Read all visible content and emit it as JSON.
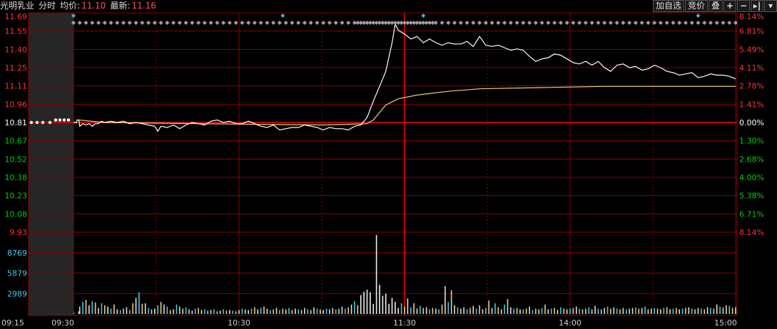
{
  "header": {
    "stock_name": "光明乳业",
    "mode_label": "分时",
    "avg_label": "均价:",
    "avg_value": "11.10",
    "last_label": "最新:",
    "last_value": "11.16"
  },
  "toolbar": {
    "add_watch_label": "加自选",
    "bid_label": "竞价",
    "overlay_label": "叠",
    "zoom_in_label": "+",
    "zoom_out_label": "−",
    "more_label": "▾"
  },
  "colors": {
    "up": "#ff3232",
    "down": "#00d000",
    "flat": "#ffffff",
    "grid": "#8b0000",
    "price_line": "#ffffff",
    "avg_line": "#e6d27a",
    "volume_axis": "#49c8e6"
  },
  "chart_data": {
    "type": "line",
    "prev_close": 10.81,
    "price_axis_labels": [
      "11.69",
      "11.55",
      "11.40",
      "11.25",
      "11.11",
      "10.96",
      "10.81",
      "10.67",
      "10.52",
      "10.38",
      "10.23",
      "10.08",
      "9.93"
    ],
    "pct_axis_labels": [
      "8.14%",
      "6.81%",
      "5.49%",
      "4.11%",
      "2.78%",
      "1.41%",
      "0.00%",
      "1.30%",
      "2.68%",
      "4.00%",
      "5.38%",
      "6.71%",
      "8.14%"
    ],
    "ylim": [
      9.93,
      11.69
    ],
    "volume_axis_labels": [
      "8769",
      "5879",
      "2989"
    ],
    "volume_max": 11659,
    "x_labels": [
      "09:15",
      "09:30",
      "10:30",
      "11:30",
      "14:00",
      "15:00"
    ],
    "price_series": [
      [
        0,
        10.81
      ],
      [
        0.14,
        10.81
      ],
      [
        0.29,
        10.81
      ],
      [
        0.43,
        10.81
      ],
      [
        0.57,
        10.81
      ],
      [
        0.71,
        10.81
      ],
      [
        0.86,
        10.81
      ],
      [
        1.0,
        10.81
      ],
      [
        1.14,
        10.83
      ],
      [
        1.29,
        10.83
      ],
      [
        1.43,
        10.83
      ],
      [
        1.57,
        10.83
      ],
      [
        1.71,
        10.83
      ],
      [
        2,
        10.78
      ],
      [
        3,
        10.8
      ],
      [
        4,
        10.79
      ],
      [
        5,
        10.8
      ],
      [
        6,
        10.78
      ],
      [
        7,
        10.8
      ],
      [
        8,
        10.8
      ],
      [
        9,
        10.82
      ],
      [
        10,
        10.81
      ],
      [
        12,
        10.82
      ],
      [
        14,
        10.81
      ],
      [
        16,
        10.82
      ],
      [
        18,
        10.8
      ],
      [
        20,
        10.81
      ],
      [
        22,
        10.8
      ],
      [
        24,
        10.79
      ],
      [
        26,
        10.78
      ],
      [
        27,
        10.74
      ],
      [
        28,
        10.78
      ],
      [
        30,
        10.77
      ],
      [
        32,
        10.79
      ],
      [
        34,
        10.76
      ],
      [
        36,
        10.79
      ],
      [
        38,
        10.81
      ],
      [
        40,
        10.8
      ],
      [
        42,
        10.79
      ],
      [
        44,
        10.82
      ],
      [
        46,
        10.83
      ],
      [
        48,
        10.81
      ],
      [
        50,
        10.82
      ],
      [
        52,
        10.8
      ],
      [
        54,
        10.8
      ],
      [
        56,
        10.82
      ],
      [
        58,
        10.8
      ],
      [
        60,
        10.78
      ],
      [
        62,
        10.77
      ],
      [
        64,
        10.79
      ],
      [
        66,
        10.75
      ],
      [
        68,
        10.76
      ],
      [
        70,
        10.77
      ],
      [
        72,
        10.77
      ],
      [
        74,
        10.79
      ],
      [
        76,
        10.78
      ],
      [
        78,
        10.77
      ],
      [
        80,
        10.75
      ],
      [
        82,
        10.77
      ],
      [
        84,
        10.76
      ],
      [
        86,
        10.76
      ],
      [
        88,
        10.75
      ],
      [
        90,
        10.78
      ],
      [
        92,
        10.79
      ],
      [
        94,
        10.85
      ],
      [
        96,
        10.98
      ],
      [
        98,
        11.1
      ],
      [
        100,
        11.22
      ],
      [
        102,
        11.45
      ],
      [
        103,
        11.6
      ],
      [
        104,
        11.55
      ],
      [
        106,
        11.52
      ],
      [
        108,
        11.48
      ],
      [
        110,
        11.5
      ],
      [
        112,
        11.45
      ],
      [
        114,
        11.48
      ],
      [
        116,
        11.45
      ],
      [
        118,
        11.43
      ],
      [
        120,
        11.45
      ],
      [
        122,
        11.44
      ],
      [
        124,
        11.44
      ],
      [
        126,
        11.46
      ],
      [
        128,
        11.42
      ],
      [
        130,
        11.5
      ],
      [
        132,
        11.43
      ],
      [
        134,
        11.42
      ],
      [
        136,
        11.43
      ],
      [
        138,
        11.41
      ],
      [
        140,
        11.39
      ],
      [
        142,
        11.4
      ],
      [
        144,
        11.39
      ],
      [
        146,
        11.34
      ],
      [
        148,
        11.3
      ],
      [
        150,
        11.32
      ],
      [
        152,
        11.33
      ],
      [
        154,
        11.36
      ],
      [
        156,
        11.35
      ],
      [
        158,
        11.32
      ],
      [
        160,
        11.29
      ],
      [
        162,
        11.28
      ],
      [
        164,
        11.3
      ],
      [
        166,
        11.27
      ],
      [
        168,
        11.3
      ],
      [
        170,
        11.25
      ],
      [
        172,
        11.22
      ],
      [
        174,
        11.27
      ],
      [
        176,
        11.28
      ],
      [
        178,
        11.25
      ],
      [
        180,
        11.26
      ],
      [
        182,
        11.23
      ],
      [
        184,
        11.24
      ],
      [
        186,
        11.27
      ],
      [
        188,
        11.25
      ],
      [
        190,
        11.22
      ],
      [
        192,
        11.21
      ],
      [
        194,
        11.19
      ],
      [
        196,
        11.2
      ],
      [
        198,
        11.21
      ],
      [
        200,
        11.17
      ],
      [
        202,
        11.18
      ],
      [
        204,
        11.2
      ],
      [
        206,
        11.19
      ],
      [
        208,
        11.19
      ],
      [
        210,
        11.18
      ],
      [
        212,
        11.16
      ]
    ],
    "avg_series": [
      [
        1.71,
        10.83
      ],
      [
        10,
        10.81
      ],
      [
        40,
        10.8
      ],
      [
        80,
        10.79
      ],
      [
        94,
        10.8
      ],
      [
        96,
        10.83
      ],
      [
        100,
        10.95
      ],
      [
        104,
        11.0
      ],
      [
        110,
        11.03
      ],
      [
        120,
        11.06
      ],
      [
        130,
        11.08
      ],
      [
        150,
        11.09
      ],
      [
        170,
        11.1
      ],
      [
        190,
        11.1
      ],
      [
        212,
        11.1
      ]
    ],
    "volume_bars": [
      [
        0.14,
        200
      ],
      [
        1.71,
        400
      ],
      [
        2,
        1100
      ],
      [
        3,
        1800
      ],
      [
        4,
        2100
      ],
      [
        5,
        1300
      ],
      [
        6,
        1900
      ],
      [
        7,
        1700
      ],
      [
        8,
        900
      ],
      [
        9,
        1600
      ],
      [
        10,
        1300
      ],
      [
        11,
        1100
      ],
      [
        12,
        800
      ],
      [
        13,
        1400
      ],
      [
        14,
        700
      ],
      [
        15,
        600
      ],
      [
        16,
        800
      ],
      [
        17,
        1000
      ],
      [
        18,
        600
      ],
      [
        19,
        1600
      ],
      [
        20,
        2400
      ],
      [
        21,
        3200
      ],
      [
        22,
        1500
      ],
      [
        23,
        1600
      ],
      [
        24,
        900
      ],
      [
        25,
        700
      ],
      [
        26,
        800
      ],
      [
        27,
        1300
      ],
      [
        28,
        1800
      ],
      [
        29,
        1400
      ],
      [
        30,
        1100
      ],
      [
        31,
        600
      ],
      [
        32,
        700
      ],
      [
        33,
        1400
      ],
      [
        34,
        1100
      ],
      [
        35,
        800
      ],
      [
        36,
        1000
      ],
      [
        37,
        700
      ],
      [
        38,
        500
      ],
      [
        39,
        800
      ],
      [
        40,
        900
      ],
      [
        41,
        600
      ],
      [
        42,
        700
      ],
      [
        43,
        500
      ],
      [
        44,
        600
      ],
      [
        45,
        700
      ],
      [
        46,
        400
      ],
      [
        47,
        500
      ],
      [
        48,
        700
      ],
      [
        49,
        500
      ],
      [
        50,
        600
      ],
      [
        51,
        500
      ],
      [
        52,
        400
      ],
      [
        53,
        600
      ],
      [
        54,
        800
      ],
      [
        55,
        700
      ],
      [
        56,
        600
      ],
      [
        57,
        800
      ],
      [
        58,
        1000
      ],
      [
        59,
        700
      ],
      [
        60,
        900
      ],
      [
        61,
        1100
      ],
      [
        62,
        800
      ],
      [
        63,
        600
      ],
      [
        64,
        700
      ],
      [
        65,
        900
      ],
      [
        66,
        600
      ],
      [
        67,
        800
      ],
      [
        68,
        700
      ],
      [
        69,
        900
      ],
      [
        70,
        600
      ],
      [
        71,
        800
      ],
      [
        72,
        700
      ],
      [
        73,
        600
      ],
      [
        74,
        900
      ],
      [
        75,
        700
      ],
      [
        76,
        600
      ],
      [
        77,
        1000
      ],
      [
        78,
        800
      ],
      [
        79,
        700
      ],
      [
        80,
        600
      ],
      [
        81,
        800
      ],
      [
        82,
        700
      ],
      [
        83,
        900
      ],
      [
        84,
        700
      ],
      [
        85,
        800
      ],
      [
        86,
        1100
      ],
      [
        87,
        800
      ],
      [
        88,
        1000
      ],
      [
        89,
        1400
      ],
      [
        90,
        1900
      ],
      [
        91,
        1300
      ],
      [
        92,
        2800
      ],
      [
        93,
        3300
      ],
      [
        94,
        3600
      ],
      [
        95,
        3200
      ],
      [
        96,
        1500
      ],
      [
        97,
        11659
      ],
      [
        98,
        4300
      ],
      [
        99,
        2700
      ],
      [
        100,
        3000
      ],
      [
        101,
        1500
      ],
      [
        102,
        2400
      ],
      [
        103,
        1800
      ],
      [
        104,
        900
      ],
      [
        105,
        1600
      ],
      [
        106,
        1100
      ],
      [
        107,
        2300
      ],
      [
        108,
        1000
      ],
      [
        109,
        1600
      ],
      [
        110,
        800
      ],
      [
        111,
        1200
      ],
      [
        112,
        900
      ],
      [
        113,
        1000
      ],
      [
        114,
        700
      ],
      [
        115,
        900
      ],
      [
        116,
        800
      ],
      [
        117,
        700
      ],
      [
        118,
        1400
      ],
      [
        119,
        4100
      ],
      [
        120,
        1800
      ],
      [
        121,
        3500
      ],
      [
        122,
        1300
      ],
      [
        123,
        1000
      ],
      [
        124,
        800
      ],
      [
        125,
        1000
      ],
      [
        126,
        700
      ],
      [
        127,
        900
      ],
      [
        128,
        1200
      ],
      [
        129,
        800
      ],
      [
        130,
        1300
      ],
      [
        131,
        700
      ],
      [
        132,
        900
      ],
      [
        133,
        2000
      ],
      [
        134,
        900
      ],
      [
        135,
        1600
      ],
      [
        136,
        1000
      ],
      [
        137,
        700
      ],
      [
        138,
        1400
      ],
      [
        139,
        2200
      ],
      [
        140,
        1000
      ],
      [
        141,
        800
      ],
      [
        142,
        900
      ],
      [
        143,
        700
      ],
      [
        144,
        700
      ],
      [
        145,
        800
      ],
      [
        146,
        1100
      ],
      [
        147,
        600
      ],
      [
        148,
        800
      ],
      [
        149,
        700
      ],
      [
        150,
        900
      ],
      [
        151,
        1400
      ],
      [
        152,
        700
      ],
      [
        153,
        800
      ],
      [
        154,
        900
      ],
      [
        155,
        600
      ],
      [
        156,
        1000
      ],
      [
        157,
        800
      ],
      [
        158,
        700
      ],
      [
        159,
        800
      ],
      [
        160,
        900
      ],
      [
        161,
        1100
      ],
      [
        162,
        800
      ],
      [
        163,
        700
      ],
      [
        164,
        800
      ],
      [
        165,
        1000
      ],
      [
        166,
        700
      ],
      [
        167,
        1200
      ],
      [
        168,
        800
      ],
      [
        169,
        700
      ],
      [
        170,
        900
      ],
      [
        171,
        1100
      ],
      [
        172,
        800
      ],
      [
        173,
        1000
      ],
      [
        174,
        800
      ],
      [
        175,
        700
      ],
      [
        176,
        900
      ],
      [
        177,
        700
      ],
      [
        178,
        800
      ],
      [
        179,
        900
      ],
      [
        180,
        1000
      ],
      [
        181,
        800
      ],
      [
        182,
        900
      ],
      [
        183,
        1100
      ],
      [
        184,
        700
      ],
      [
        185,
        800
      ],
      [
        186,
        900
      ],
      [
        187,
        800
      ],
      [
        188,
        700
      ],
      [
        189,
        900
      ],
      [
        190,
        1000
      ],
      [
        191,
        700
      ],
      [
        192,
        800
      ],
      [
        193,
        900
      ],
      [
        194,
        700
      ],
      [
        195,
        800
      ],
      [
        196,
        900
      ],
      [
        197,
        1000
      ],
      [
        198,
        800
      ],
      [
        199,
        700
      ],
      [
        200,
        900
      ],
      [
        201,
        800
      ],
      [
        202,
        700
      ],
      [
        203,
        1000
      ],
      [
        204,
        900
      ],
      [
        205,
        800
      ],
      [
        206,
        1400
      ],
      [
        207,
        1100
      ],
      [
        208,
        1000
      ],
      [
        209,
        1300
      ],
      [
        210,
        1200
      ],
      [
        211,
        900
      ],
      [
        212,
        1000
      ]
    ],
    "signals_gray": [
      0,
      1,
      2,
      3,
      4,
      5,
      6,
      7,
      8,
      9,
      10,
      11,
      12,
      13,
      14,
      15,
      16,
      17,
      18,
      19,
      20,
      21,
      22,
      23,
      24,
      25,
      26,
      27,
      28,
      29,
      30,
      31,
      32,
      33,
      34,
      35,
      36,
      37,
      38,
      39,
      40,
      41,
      42,
      43,
      44,
      45,
      46,
      47,
      48,
      49,
      50,
      51,
      52,
      53,
      54,
      55,
      56,
      57,
      58,
      59,
      60,
      61,
      62,
      63,
      64,
      65,
      66,
      67,
      68,
      69,
      70,
      71,
      72,
      73,
      74,
      75,
      76,
      77,
      78,
      79,
      80,
      81,
      82,
      83,
      84,
      85,
      86,
      87,
      88,
      89,
      90,
      91,
      92,
      93,
      94,
      95,
      96,
      97,
      98,
      99,
      100,
      101,
      102,
      103,
      104,
      105,
      106,
      107,
      108,
      109,
      110,
      111,
      112,
      113,
      114,
      115,
      116,
      117,
      118,
      119,
      120,
      121,
      122,
      123,
      124,
      125,
      126,
      127,
      128,
      129,
      130,
      131,
      132,
      133,
      134,
      135,
      136,
      137,
      138,
      139,
      140,
      141,
      142,
      143,
      144,
      145,
      146,
      147,
      148,
      149,
      150,
      151,
      152,
      153,
      154,
      155,
      156,
      157,
      158,
      159,
      160,
      161,
      162,
      163,
      164,
      165,
      166,
      167,
      168,
      169,
      170,
      171,
      172,
      173,
      174,
      175,
      176,
      177,
      178,
      179,
      180,
      181,
      182,
      183,
      184,
      185,
      186,
      187,
      188,
      189,
      190,
      191,
      192,
      193,
      194,
      195,
      196,
      197,
      198,
      199,
      200,
      201,
      202,
      203,
      204,
      205,
      206,
      207,
      208,
      209,
      210,
      211,
      212
    ],
    "signals_blue": [
      0,
      67,
      112,
      200
    ]
  }
}
